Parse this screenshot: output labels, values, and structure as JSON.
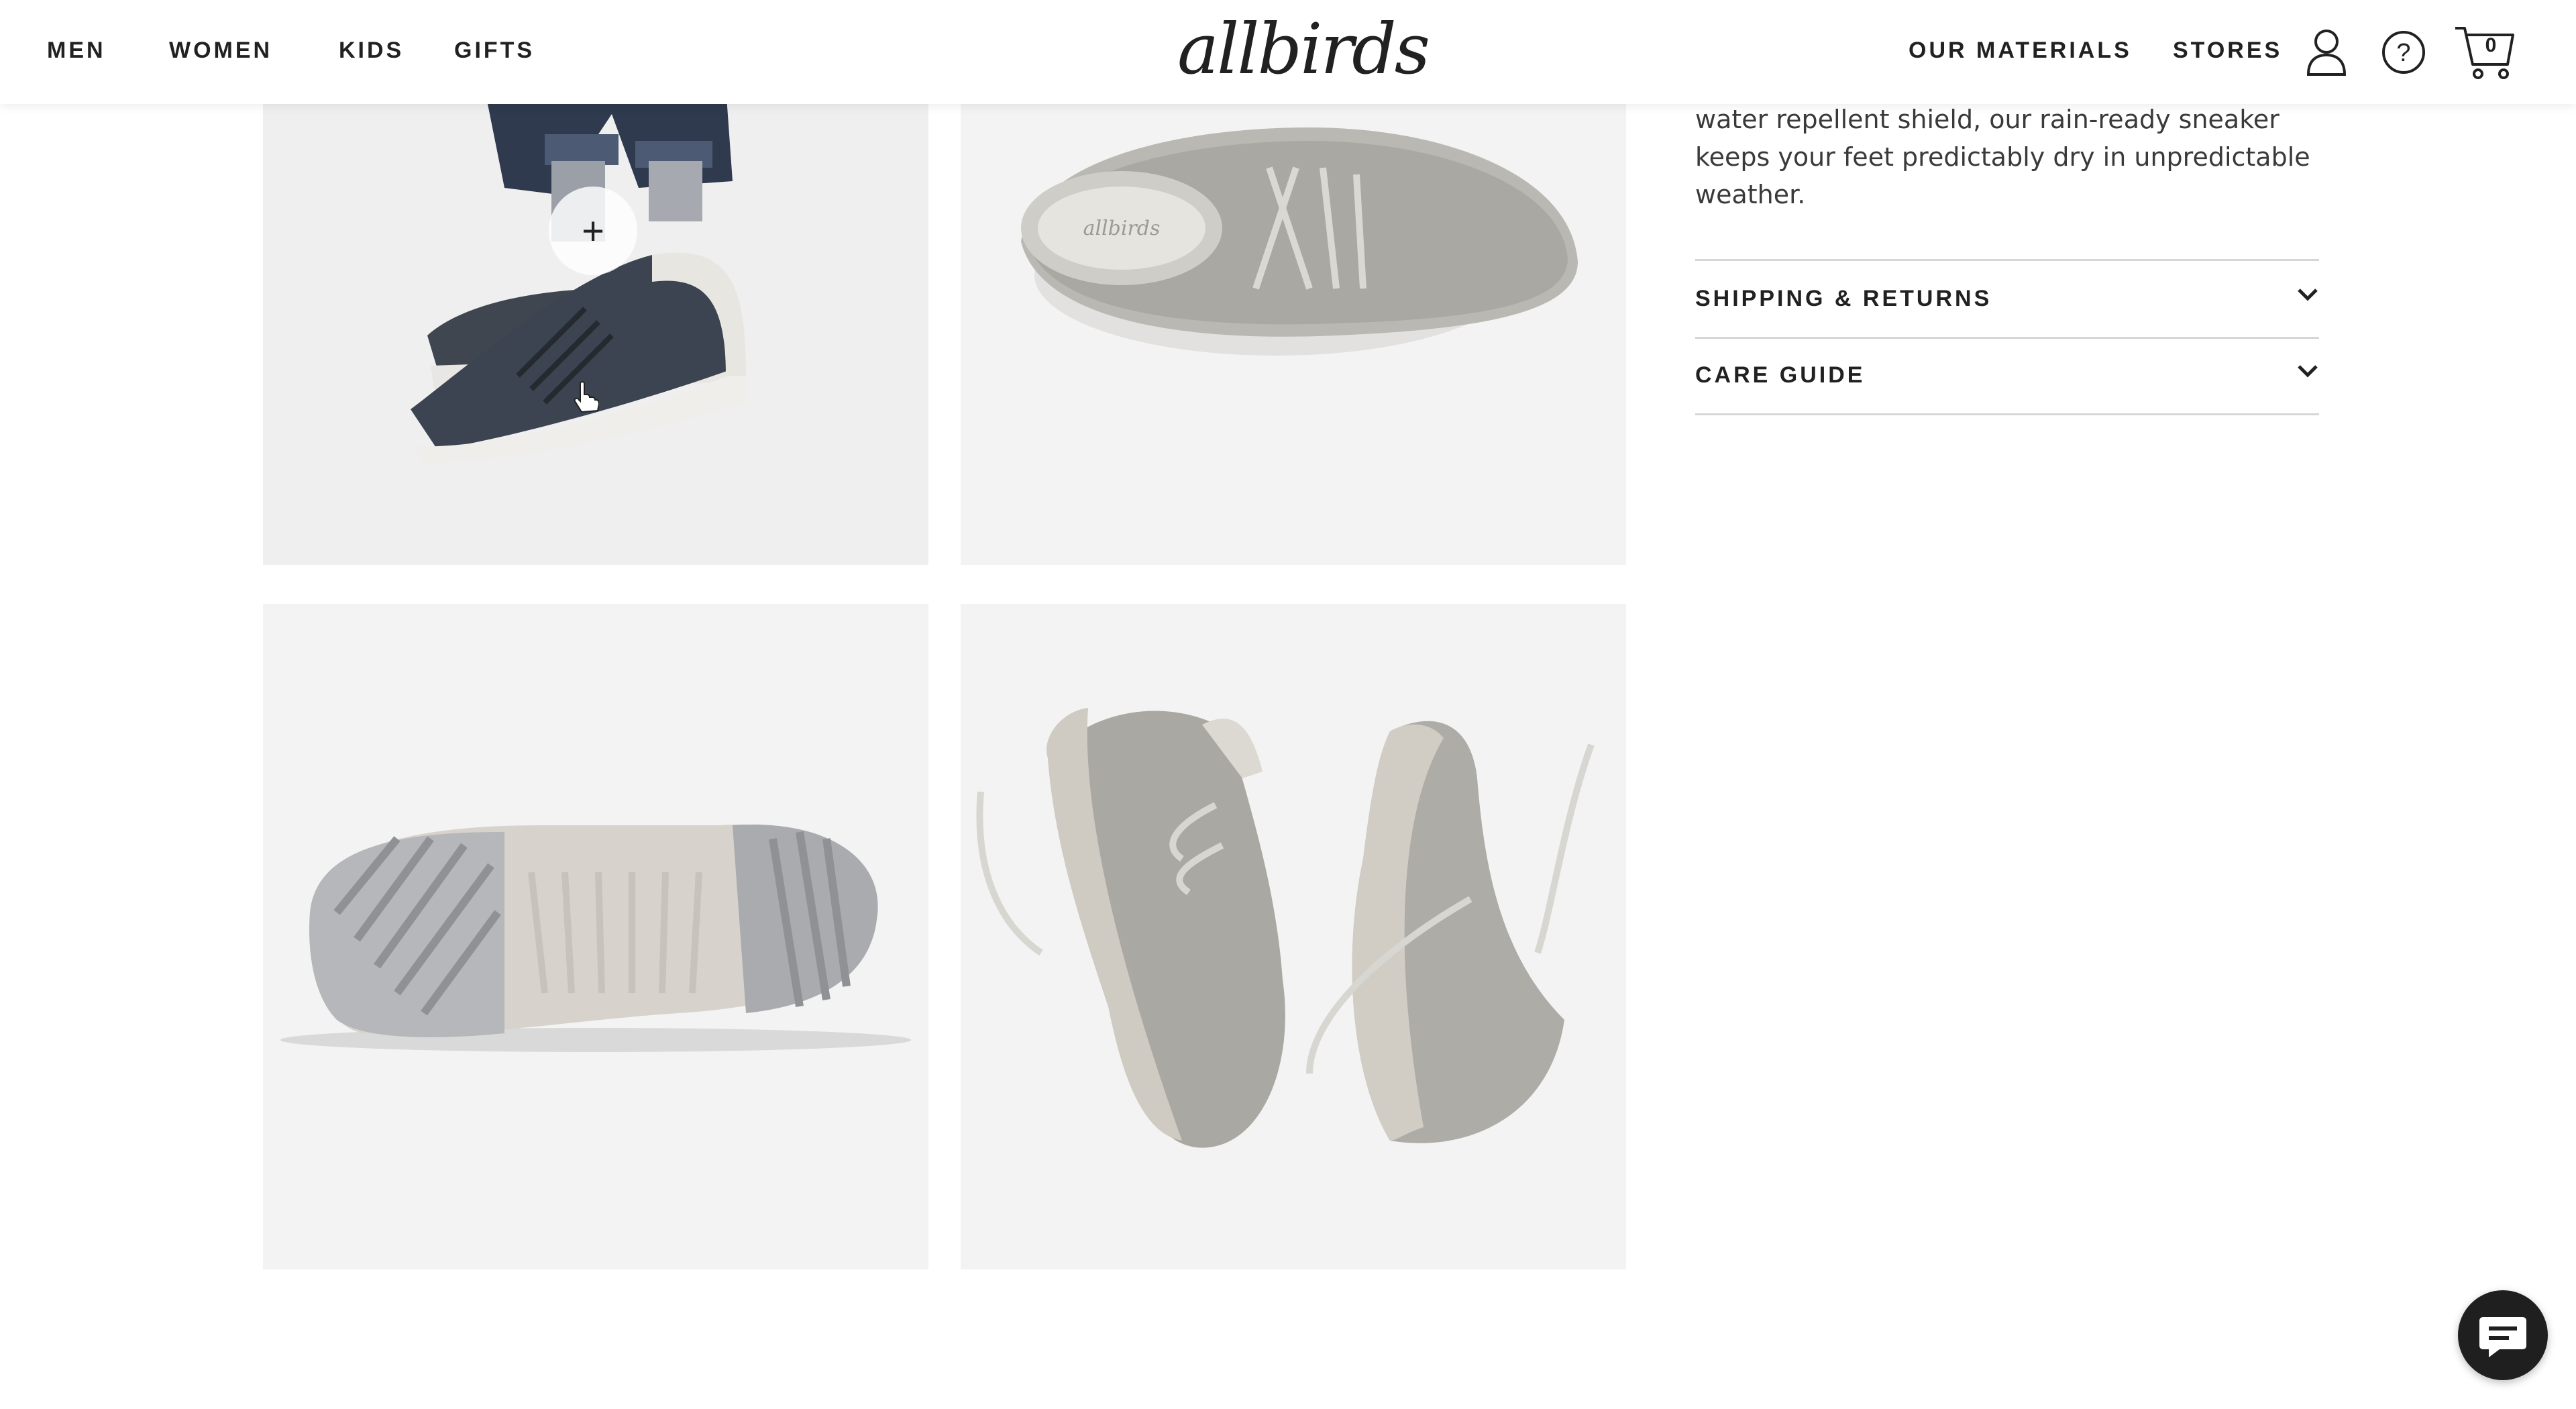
{
  "header": {
    "nav_left": [
      "MEN",
      "WOMEN",
      "KIDS",
      "GIFTS"
    ],
    "logo": "allbirds",
    "nav_right": [
      "OUR MATERIALS",
      "STORES"
    ],
    "icons": [
      "account-icon",
      "help-icon",
      "cart-icon"
    ],
    "cart_count": "0"
  },
  "gallery": {
    "images": [
      "model-wearing-sneaker",
      "sneaker-top-view",
      "sneaker-sole-view",
      "sneaker-pair-view"
    ],
    "zoom_icon": "plus-icon"
  },
  "product": {
    "description": "water repellent shield, our rain-ready sneaker keeps your feet predictably dry in unpredictable weather.",
    "accordions": [
      {
        "label": "SHIPPING & RETURNS",
        "icon": "chevron-down-icon"
      },
      {
        "label": "CARE GUIDE",
        "icon": "chevron-down-icon"
      }
    ]
  },
  "chat": {
    "icon": "chat-icon"
  },
  "colors": {
    "text": "#212121",
    "tile_bg": "#f3f3f3",
    "divider": "#d6d6d6",
    "chat_bg": "#1f1f1f"
  }
}
